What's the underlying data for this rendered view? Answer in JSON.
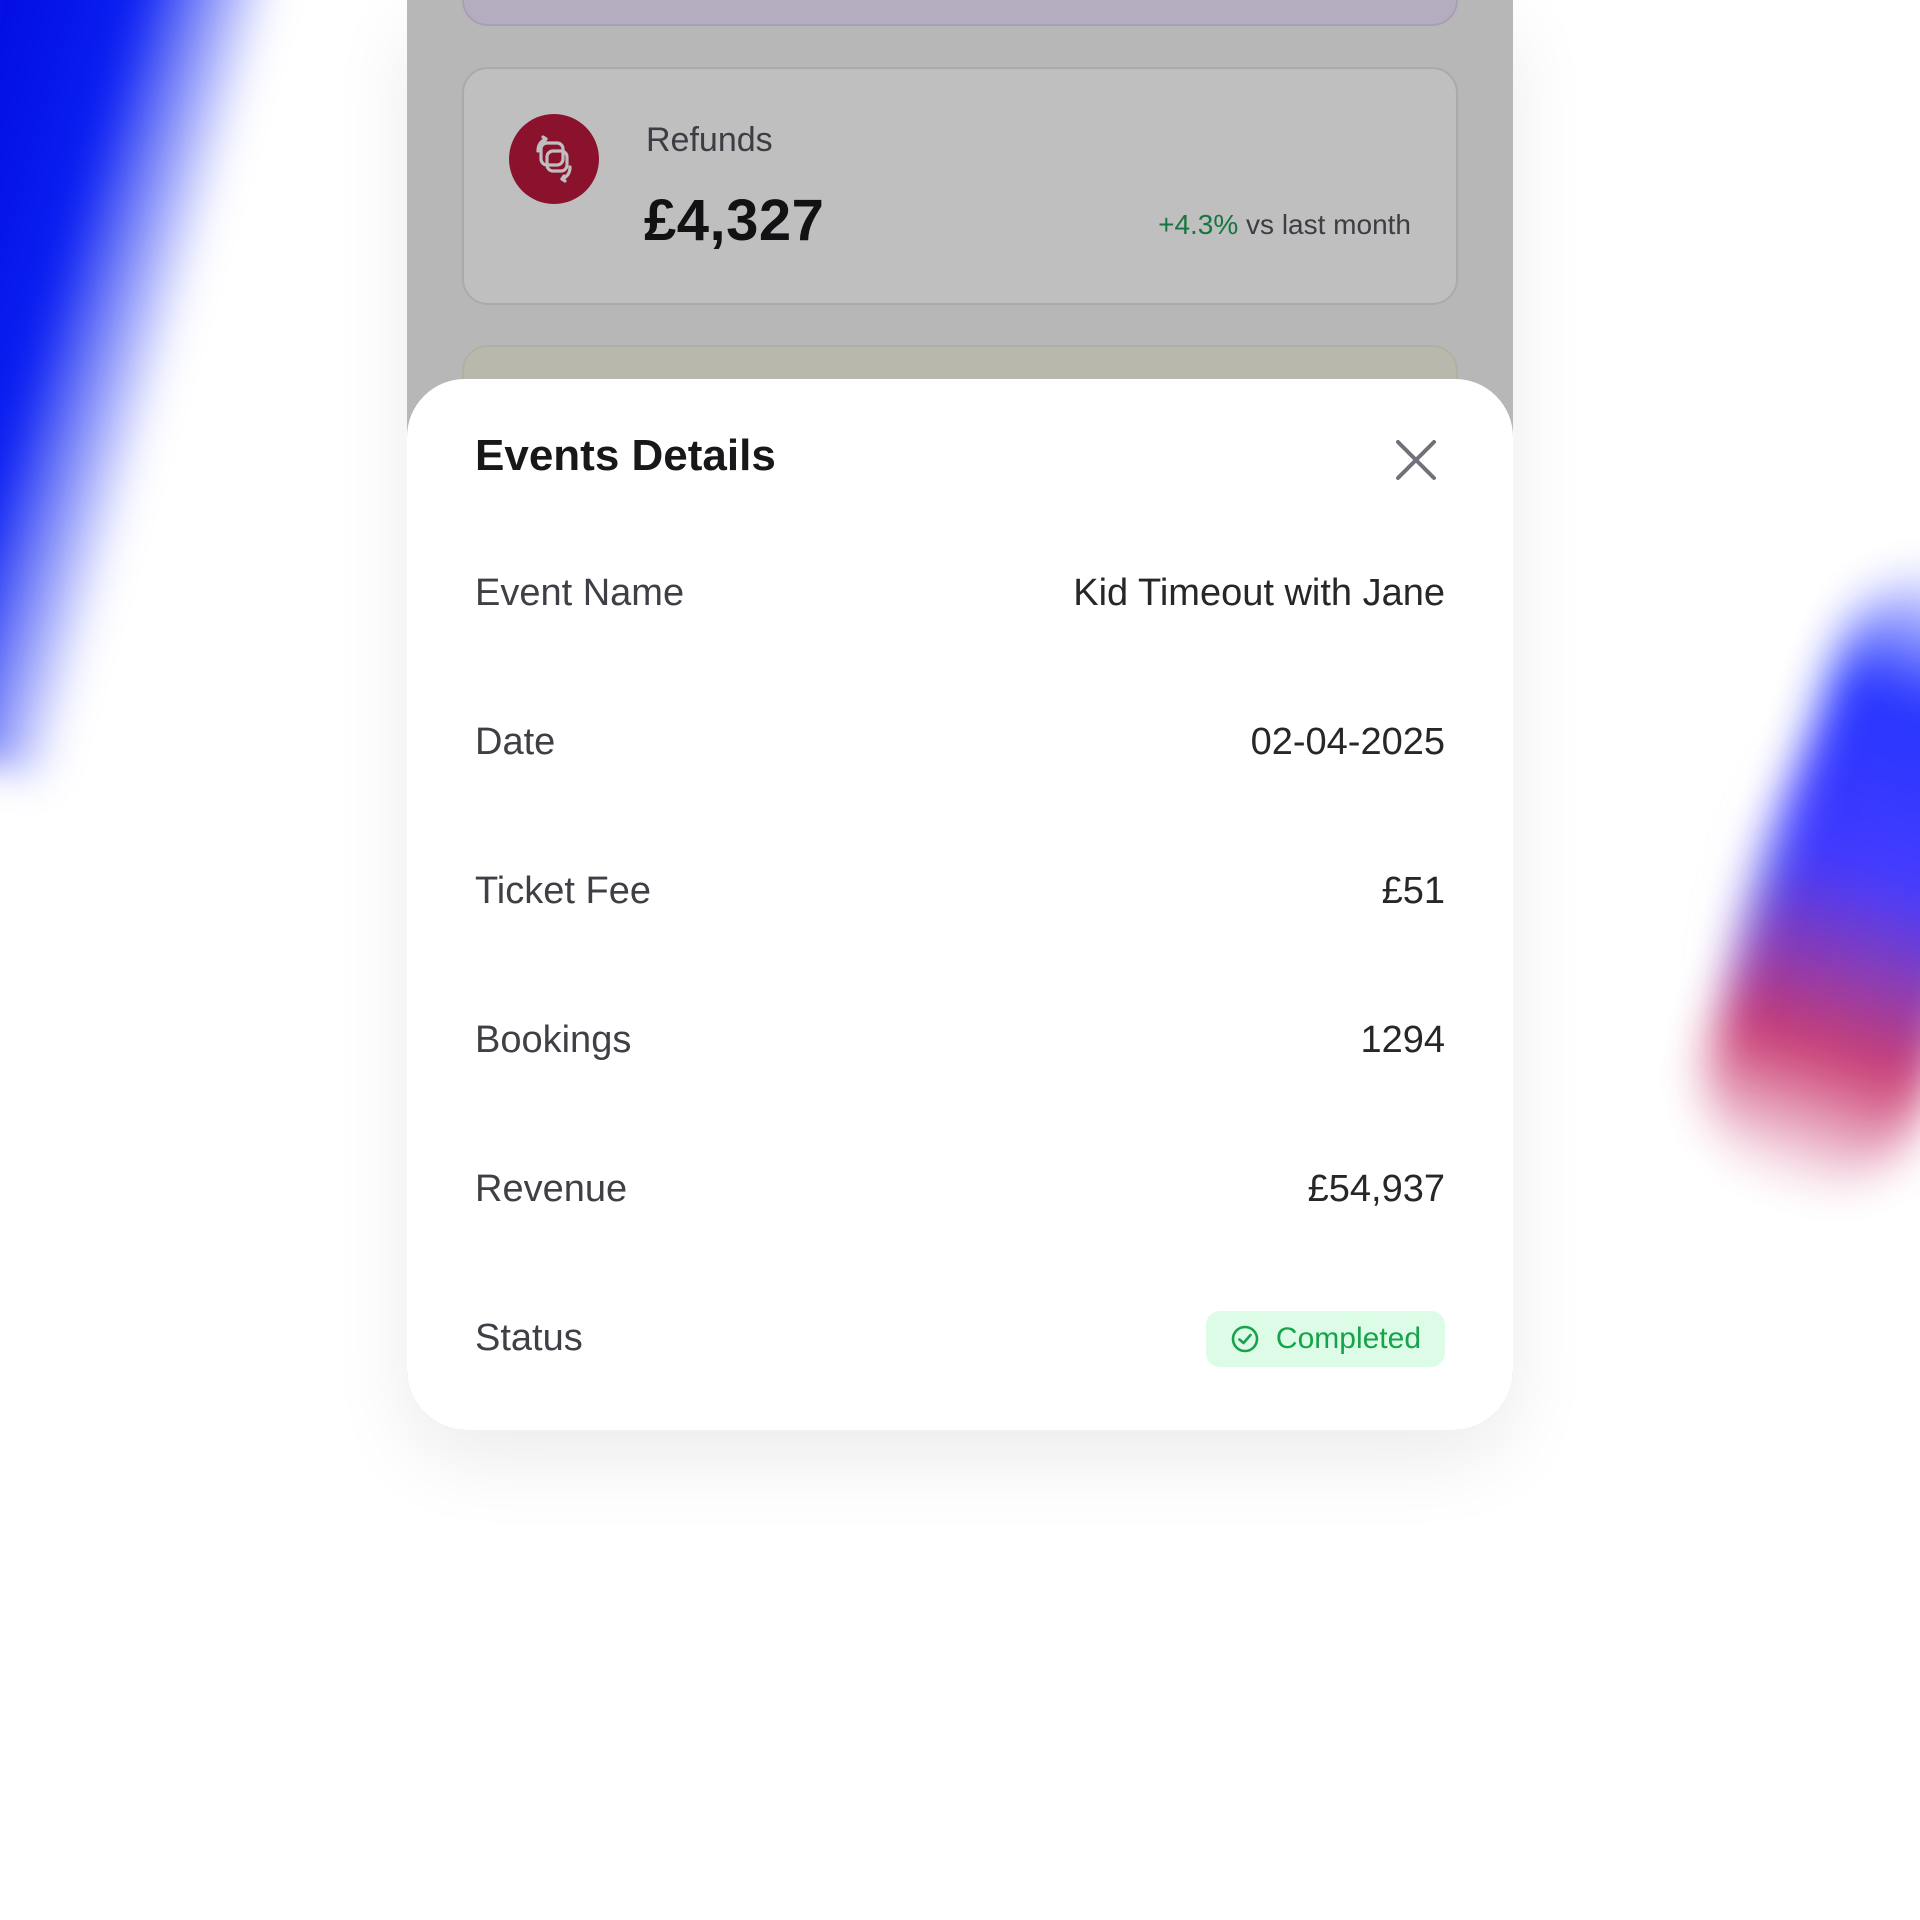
{
  "background_card": {
    "label": "Refunds",
    "value": "£4,327",
    "trend_pct": "+4.3%",
    "trend_text": " vs last month"
  },
  "modal": {
    "title": "Events Details",
    "rows": [
      {
        "label": "Event Name",
        "value": "Kid Timeout with Jane"
      },
      {
        "label": "Date",
        "value": "02-04-2025"
      },
      {
        "label": "Ticket Fee",
        "value": "£51"
      },
      {
        "label": "Bookings",
        "value": "1294"
      },
      {
        "label": "Revenue",
        "value": "£54,937"
      },
      {
        "label": "Status",
        "value": "Completed"
      }
    ]
  },
  "colors": {
    "refund_icon_bg": "#b8193c",
    "trend_positive": "#1f9d55",
    "status_bg": "#dcfce7",
    "status_text": "#16a34a"
  },
  "icons": {
    "refund": "refresh-squares-icon",
    "close": "close-icon",
    "status": "check-circle-icon"
  }
}
